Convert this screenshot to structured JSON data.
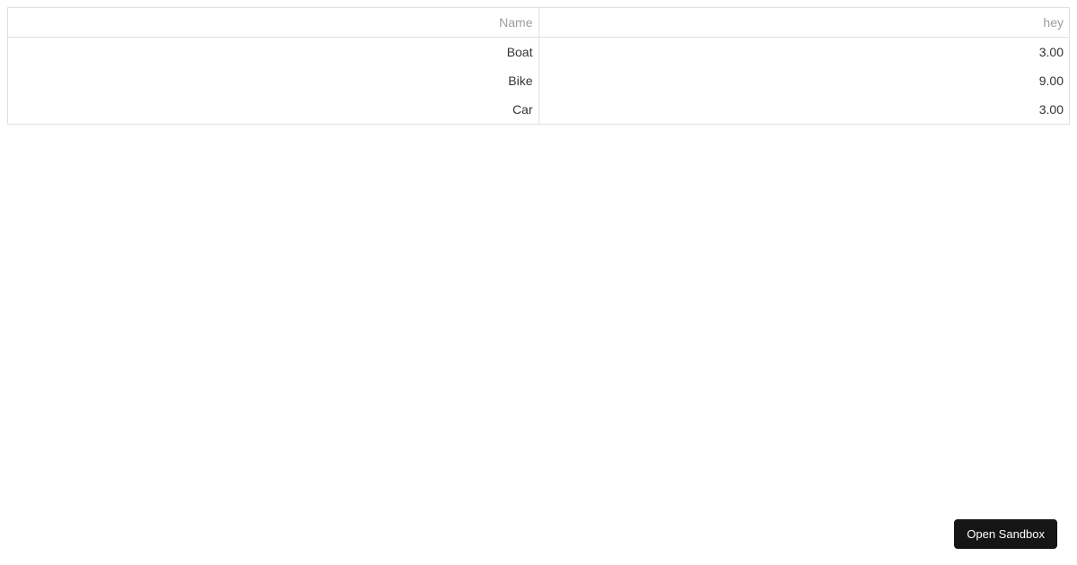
{
  "table": {
    "columns": [
      {
        "label": "Name"
      },
      {
        "label": "hey"
      }
    ],
    "rows": [
      {
        "name": "Boat",
        "value": "3.00"
      },
      {
        "name": "Bike",
        "value": "9.00"
      },
      {
        "name": "Car",
        "value": "3.00"
      }
    ]
  },
  "button": {
    "open_sandbox": "Open Sandbox"
  }
}
